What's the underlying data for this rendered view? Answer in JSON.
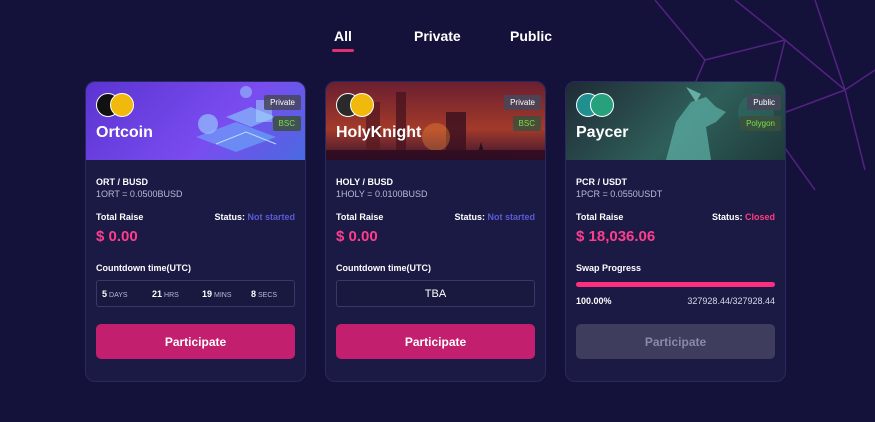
{
  "tabs": [
    {
      "label": "All",
      "active": true
    },
    {
      "label": "Private",
      "active": false
    },
    {
      "label": "Public",
      "active": false
    }
  ],
  "cards": [
    {
      "name": "Ortcoin",
      "type_badge": "Private",
      "chain_badge": "BSC",
      "pair": "ORT / BUSD",
      "rate": "1ORT = 0.0500BUSD",
      "total_raise_label": "Total Raise",
      "status_label": "Status:",
      "status_value": "Not started",
      "raise": "$ 0.00",
      "countdown_label": "Countdown time(UTC)",
      "countdown": [
        {
          "num": "5",
          "unit": "DAYS"
        },
        {
          "num": "21",
          "unit": "HRS"
        },
        {
          "num": "19",
          "unit": "MINS"
        },
        {
          "num": "8",
          "unit": "SECS"
        }
      ],
      "button": "Participate",
      "banner_color": "#6a3ee0"
    },
    {
      "name": "HolyKnight",
      "type_badge": "Private",
      "chain_badge": "BSC",
      "pair": "HOLY / BUSD",
      "rate": "1HOLY = 0.0100BUSD",
      "total_raise_label": "Total Raise",
      "status_label": "Status:",
      "status_value": "Not started",
      "raise": "$ 0.00",
      "countdown_label": "Countdown time(UTC)",
      "countdown_value": "TBA",
      "button": "Participate",
      "banner_color": "#8a2a3a"
    },
    {
      "name": "Paycer",
      "type_badge": "Public",
      "chain_badge": "Polygon",
      "pair": "PCR / USDT",
      "rate": "1PCR = 0.0550USDT",
      "total_raise_label": "Total Raise",
      "status_label": "Status:",
      "status_value": "Closed",
      "raise": "$ 18,036.06",
      "swap_label": "Swap Progress",
      "progress": 1.0,
      "progress_text": "100.00%",
      "progress_amount": "327928.44/327928.44",
      "button": "Participate",
      "banner_color": "#2d5a5a"
    }
  ],
  "colors": {
    "background": "#14123a",
    "accent": "#e0306f",
    "card": "#1b1a45"
  }
}
